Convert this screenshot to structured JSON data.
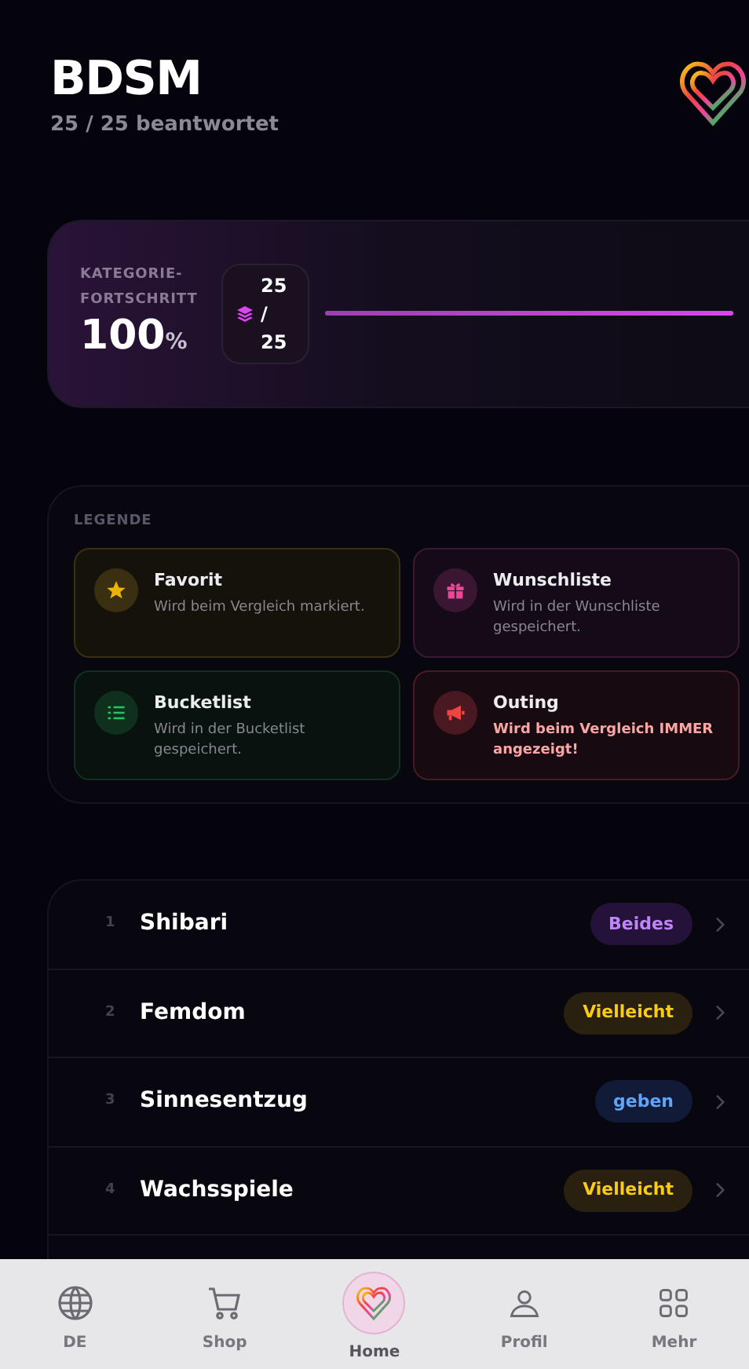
{
  "header": {
    "title": "BDSM",
    "subtitle": "25 / 25 beantwortet"
  },
  "progress": {
    "label": "KATEGORIE-FORTSCHRITT",
    "percent": "100",
    "percent_sign": "%",
    "count": "25",
    "separator": "/",
    "total": "25",
    "level": 1
  },
  "legend": {
    "title": "LEGENDE",
    "items": [
      {
        "kind": "favorite",
        "title": "Favorit",
        "text": "Wird beim Vergleich markiert."
      },
      {
        "kind": "wish",
        "title": "Wunschliste",
        "text": "Wird in der Wunschliste gespeichert."
      },
      {
        "kind": "bucket",
        "title": "Bucketlist",
        "text": "Wird in der Bucketlist gespeichert."
      },
      {
        "kind": "outing",
        "title": "Outing",
        "text": "Wird beim Vergleich IMMER angezeigt!"
      }
    ]
  },
  "questions": [
    {
      "number": "1",
      "name": "Shibari",
      "answer": "Beides",
      "kind": "both"
    },
    {
      "number": "2",
      "name": "Femdom",
      "answer": "Vielleicht",
      "kind": "maybe"
    },
    {
      "number": "3",
      "name": "Sinnesentzug",
      "answer": "geben",
      "kind": "give"
    },
    {
      "number": "4",
      "name": "Wachsspiele",
      "answer": "Vielleicht",
      "kind": "maybe"
    }
  ],
  "nav": [
    {
      "kind": "globe",
      "label": "DE",
      "selected": false
    },
    {
      "kind": "cart",
      "label": "Shop",
      "selected": false
    },
    {
      "kind": "home",
      "label": "Home",
      "selected": true
    },
    {
      "kind": "user",
      "label": "Profil",
      "selected": false
    },
    {
      "kind": "grid",
      "label": "Mehr",
      "selected": false
    }
  ]
}
